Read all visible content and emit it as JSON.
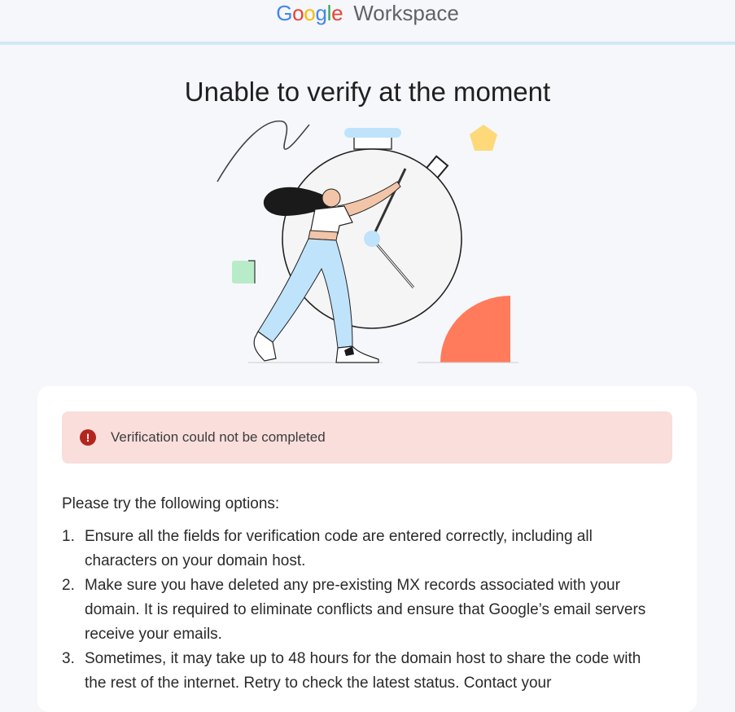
{
  "header": {
    "logo_google": "Google",
    "logo_product": "Workspace"
  },
  "page": {
    "title": "Unable to verify at the moment"
  },
  "alert": {
    "icon": "error-icon",
    "message": "Verification could not be completed",
    "color": "#b3261e",
    "background": "#f9dedc"
  },
  "content": {
    "intro": "Please try the following options:",
    "options": [
      {
        "num": "1.",
        "text": "Ensure all the fields for verification code are entered correctly, including all characters on your domain host."
      },
      {
        "num": "2.",
        "text": "Make sure you have deleted any pre-existing MX records associated with your domain. It is required to eliminate conflicts and ensure that Google’s email servers receive your emails."
      },
      {
        "num": "3.",
        "text": "Sometimes, it may take up to 48 hours for the domain host to share the code with the rest of the internet. Retry to check the latest status. Contact your"
      }
    ]
  },
  "colors": {
    "google_blue": "#4285f4",
    "google_red": "#ea4335",
    "google_yellow": "#fbbc05",
    "google_green": "#34a853",
    "accent_orange": "#ff7b5c",
    "accent_light_blue": "#bfe3fb"
  }
}
